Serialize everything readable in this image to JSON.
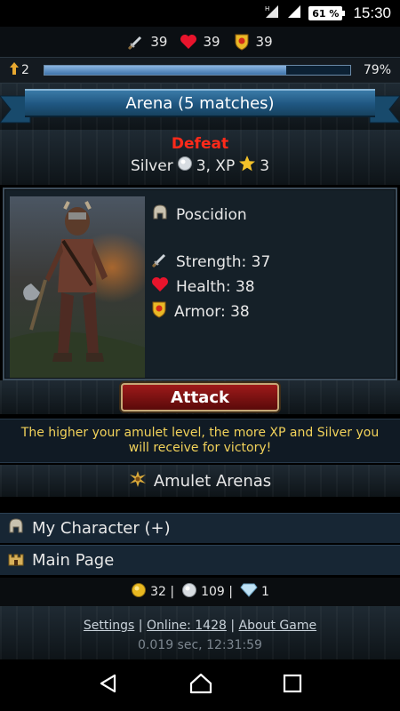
{
  "statusbar": {
    "battery": "61 %",
    "time": "15:30"
  },
  "top_stats": {
    "strength": "39",
    "health": "39",
    "armor": "39"
  },
  "level": {
    "value": "2",
    "progress_label": "79%",
    "progress": 0.79
  },
  "banner": {
    "title": "Arena (5 matches)"
  },
  "result": {
    "status": "Defeat",
    "silver_label": "Silver",
    "silver_amount": "3, XP",
    "xp_amount": "3"
  },
  "opponent": {
    "name": "Poscidion",
    "strength": "Strength: 37",
    "health": "Health: 38",
    "armor": "Armor: 38"
  },
  "attack_button": "Attack",
  "hint": "The higher your amulet level, the more XP and Silver you will receive for victory!",
  "amulet_arenas": "Amulet Arenas",
  "menu": {
    "my_character": "My Character (+)",
    "main_page": "Main Page"
  },
  "currency": {
    "gold": "32 |",
    "silver": "109 |",
    "gems": "1"
  },
  "footer": {
    "settings": "Settings",
    "online": "Online: 1428",
    "about": "About Game",
    "sep": "|",
    "timing": "0.019 sec, 12:31:59"
  },
  "colors": {
    "defeat": "#ff2a1a",
    "hint": "#f2d25a",
    "banner": "#1f5680",
    "attack": "#9e1a1a"
  }
}
